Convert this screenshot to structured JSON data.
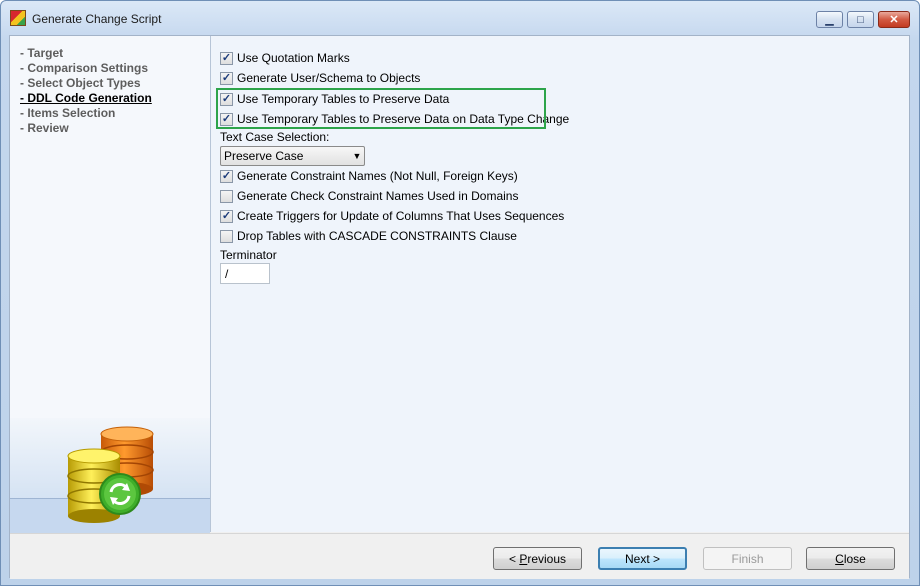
{
  "window": {
    "title": "Generate Change Script"
  },
  "steps": [
    {
      "label": "- Target",
      "current": false
    },
    {
      "label": "- Comparison Settings",
      "current": false
    },
    {
      "label": "- Select Object Types",
      "current": false
    },
    {
      "label": "- DDL Code Generation",
      "current": true
    },
    {
      "label": "- Items Selection",
      "current": false
    },
    {
      "label": "- Review",
      "current": false
    }
  ],
  "options": {
    "use_quotation_marks": {
      "label": "Use Quotation Marks",
      "checked": true
    },
    "generate_user_schema": {
      "label": "Generate User/Schema to Objects",
      "checked": true
    },
    "temp_tables_preserve": {
      "label": "Use Temporary Tables to Preserve Data",
      "checked": true
    },
    "temp_tables_type_change": {
      "label": "Use Temporary Tables to Preserve Data on Data Type Change",
      "checked": true
    },
    "constraint_names": {
      "label": "Generate Constraint Names (Not Null, Foreign Keys)",
      "checked": true
    },
    "check_constraint_names": {
      "label": "Generate Check Constraint Names Used in Domains",
      "checked": false
    },
    "create_triggers": {
      "label": "Create Triggers for Update of Columns That Uses Sequences",
      "checked": true
    },
    "drop_tables_cascade": {
      "label": "Drop Tables with CASCADE CONSTRAINTS Clause",
      "checked": false
    }
  },
  "text_case": {
    "label": "Text Case Selection:",
    "selected": "Preserve Case"
  },
  "terminator": {
    "label": "Terminator",
    "value": "/"
  },
  "buttons": {
    "previous": {
      "mnemonic": "P",
      "rest": "revious",
      "prefix": "< "
    },
    "next": "Next >",
    "finish": "Finish",
    "close": {
      "mnemonic": "C",
      "rest": "lose"
    }
  },
  "icons": {
    "app": "app-icon",
    "database": "database-icon",
    "sync": "sync-icon"
  }
}
